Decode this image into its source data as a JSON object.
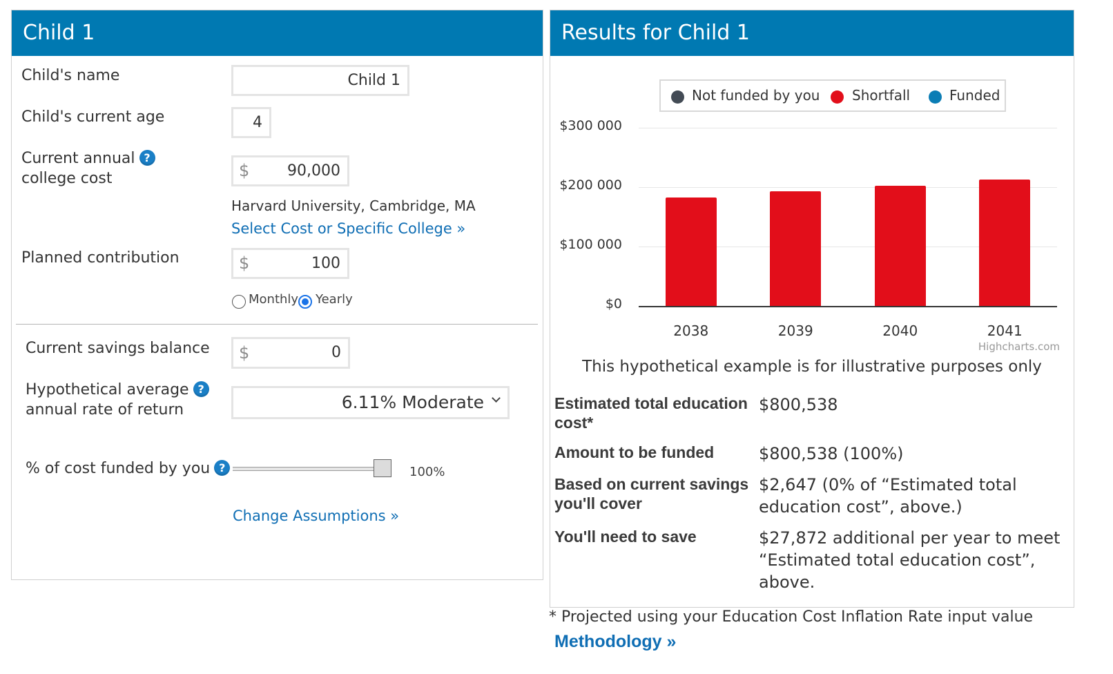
{
  "left": {
    "title": "Child 1",
    "name": {
      "label": "Child's name",
      "value": "Child 1"
    },
    "age": {
      "label": "Child's current age",
      "value": "4"
    },
    "college_cost": {
      "label_line1": "Current annual",
      "label_line2": "college cost",
      "currency": "$",
      "value": "90,000",
      "college": "Harvard University, Cambridge, MA",
      "select_link": "Select Cost or Specific College »"
    },
    "contribution": {
      "label": "Planned contribution",
      "currency": "$",
      "value": "100",
      "options": [
        "Monthly",
        "Yearly"
      ],
      "selected": "Yearly"
    },
    "savings": {
      "label": "Current savings balance",
      "currency": "$",
      "value": "0"
    },
    "return_rate": {
      "label_line1": "Hypothetical average",
      "label_line2": "annual rate of return",
      "selected": "6.11% Moderate"
    },
    "percent_funded": {
      "label": "% of cost funded by you",
      "display": "100%",
      "fraction": 1.0
    },
    "change_link": "Change Assumptions »",
    "help_glyph": "?",
    "help_icon": "question-circle-icon"
  },
  "right": {
    "title": "Results for Child 1",
    "disclaimer": "This hypothetical example is for illustrative purposes only",
    "credits": "Highcharts.com",
    "results": [
      {
        "label": "Estimated total education cost*",
        "value": "$800,538"
      },
      {
        "label": "Amount to be funded",
        "value": "$800,538 (100%)"
      },
      {
        "label": "Based on current savings you'll cover",
        "value": "$2,647 (0% of “Estimated total education cost”, above.)"
      },
      {
        "label": "You'll need to save",
        "value": "$27,872 additional per year to meet “Estimated total education cost”, above."
      }
    ]
  },
  "chart_data": {
    "type": "bar",
    "categories": [
      "2038",
      "2039",
      "2040",
      "2041"
    ],
    "series": [
      {
        "name": "Not funded by you",
        "color": "#434b55",
        "values": [
          0,
          0,
          0,
          0
        ]
      },
      {
        "name": "Shortfall",
        "color": "#e20e1a",
        "values": [
          183000,
          193000,
          202000,
          213000
        ]
      },
      {
        "name": "Funded",
        "color": "#0b7db5",
        "values": [
          0,
          0,
          0,
          0
        ]
      }
    ],
    "y_ticks": [
      "$0",
      "$100 000",
      "$200 000",
      "$300 000"
    ],
    "y_tick_values": [
      0,
      100000,
      200000,
      300000
    ],
    "ylim": [
      0,
      300000
    ],
    "grid": true,
    "legend_position": "top"
  },
  "footer": {
    "footnote": "* Projected using your Education Cost Inflation Rate input value",
    "methodology": "Methodology  »"
  },
  "colors": {
    "header": "#0079b2",
    "link": "#0f6eb4",
    "accent": "#1a73e8"
  }
}
